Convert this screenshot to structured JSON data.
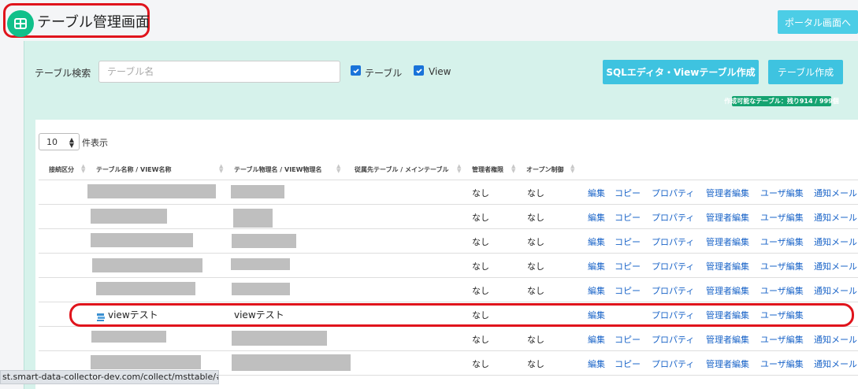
{
  "header": {
    "title": "テーブル管理画面",
    "portal_button": "ポータル画面へ"
  },
  "search": {
    "label": "テーブル検索",
    "placeholder": "テーブル名",
    "checkbox_table": "テーブル",
    "checkbox_view": "View",
    "checkbox_table_checked": true,
    "checkbox_view_checked": true
  },
  "actions": {
    "sql_button": "SQLエディタ・Viewテーブル作成",
    "create_button": "テーブル作成",
    "quota_badge": "作成可能なテーブル：残り914 / 999個"
  },
  "paging": {
    "page_size": "10",
    "page_size_label": "件表示"
  },
  "table": {
    "columns": [
      "接続区分",
      "テーブル名称 / VIEW名称",
      "テーブル物理名 / VIEW物理名",
      "従属先テーブル / メインテーブル",
      "管理者権限",
      "オープン制御"
    ],
    "rows": [
      {
        "type": "table",
        "admin": "なし",
        "open": "なし",
        "links": [
          "編集",
          "コピー",
          "プロパティ",
          "管理者編集",
          "ユーザ編集",
          "通知メール"
        ]
      },
      {
        "type": "table",
        "admin": "なし",
        "open": "なし",
        "links": [
          "編集",
          "コピー",
          "プロパティ",
          "管理者編集",
          "ユーザ編集",
          "通知メール"
        ]
      },
      {
        "type": "table",
        "admin": "なし",
        "open": "なし",
        "links": [
          "編集",
          "コピー",
          "プロパティ",
          "管理者編集",
          "ユーザ編集",
          "通知メール"
        ]
      },
      {
        "type": "table",
        "admin": "なし",
        "open": "なし",
        "links": [
          "編集",
          "コピー",
          "プロパティ",
          "管理者編集",
          "ユーザ編集",
          "通知メール"
        ]
      },
      {
        "type": "table",
        "admin": "なし",
        "open": "なし",
        "links": [
          "編集",
          "コピー",
          "プロパティ",
          "管理者編集",
          "ユーザ編集",
          "通知メール"
        ]
      },
      {
        "type": "view",
        "name": "viewテスト",
        "physical": "viewテスト",
        "admin": "なし",
        "open": "",
        "icon": "view-layers-icon",
        "links": [
          "編集",
          "",
          "プロパティ",
          "管理者編集",
          "ユーザ編集",
          ""
        ]
      },
      {
        "type": "table",
        "admin": "なし",
        "open": "なし",
        "links": [
          "編集",
          "コピー",
          "プロパティ",
          "管理者編集",
          "ユーザ編集",
          "通知メール"
        ]
      },
      {
        "type": "table",
        "admin": "なし",
        "open": "なし",
        "links": [
          "編集",
          "コピー",
          "プロパティ",
          "管理者編集",
          "ユーザ編集",
          "通知メール"
        ]
      }
    ]
  },
  "status_bar": {
    "url": "st.smart-data-collector-dev.com/collect/msttable/#"
  },
  "colors": {
    "accent": "#3ec3e0",
    "panel": "#d6f2eb",
    "link": "#1a64c8",
    "badge": "#14a370",
    "highlight": "#e0141c"
  }
}
